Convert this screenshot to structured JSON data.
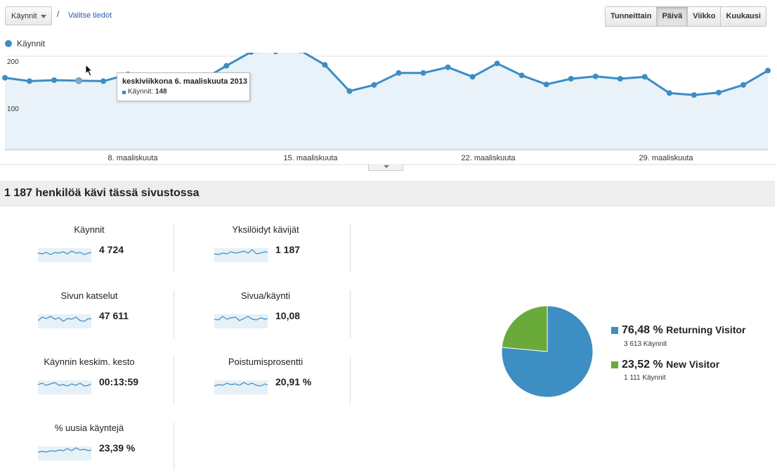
{
  "toolbar": {
    "metric_select": "Käynnit",
    "separator": "/",
    "select_data_link": "Valitse tiedot",
    "periods": [
      "Tunneittain",
      "Päivä",
      "Viikko",
      "Kuukausi"
    ],
    "active_period": "Päivä"
  },
  "chart_legend": {
    "label": "Käynnit",
    "color": "#3b8dc4"
  },
  "tooltip": {
    "date": "keskiviikkona 6. maaliskuuta 2013",
    "metric": "Käynnit:",
    "value": "148"
  },
  "chart_data": {
    "type": "area",
    "series": [
      {
        "name": "Käynnit",
        "values": [
          155,
          148,
          150,
          149,
          148,
          162,
          152,
          125,
          150,
          180,
          209,
          210,
          212,
          182,
          127,
          140,
          165,
          165,
          177,
          157,
          185,
          160,
          141,
          153,
          158,
          153,
          157,
          123,
          119,
          124,
          140,
          170
        ]
      }
    ],
    "x_tick_labels": [
      "8. maaliskuuta",
      "15. maaliskuuta",
      "22. maaliskuuta",
      "29. maaliskuuta"
    ],
    "y_tick_labels": [
      "200",
      "100"
    ],
    "ylim": [
      0,
      250
    ],
    "grid": true,
    "color": "#3b8dc4"
  },
  "summary": {
    "title": "1 187 henkilöä kävi tässä sivustossa"
  },
  "metrics": [
    {
      "name": "Käynnit",
      "value": "4 724"
    },
    {
      "name": "Yksilöidyt kävijät",
      "value": "1 187"
    },
    {
      "name": "Sivun katselut",
      "value": "47 611"
    },
    {
      "name": "Sivua/käynti",
      "value": "10,08"
    },
    {
      "name": "Käynnin keskim. kesto",
      "value": "00:13:59"
    },
    {
      "name": "Poistumisprosentti",
      "value": "20,91 %"
    },
    {
      "name": "% uusia käyntejä",
      "value": "23,39 %"
    }
  ],
  "pie": {
    "slices": [
      {
        "label": "Returning Visitor",
        "percent_text": "76,48 %",
        "fraction": 0.7648,
        "sub": "3 613 Käynnit",
        "color": "#3d8ec2"
      },
      {
        "label": "New Visitor",
        "percent_text": "23,52 %",
        "fraction": 0.2352,
        "sub": "1 111 Käynnit",
        "color": "#6aaa3a"
      }
    ]
  }
}
